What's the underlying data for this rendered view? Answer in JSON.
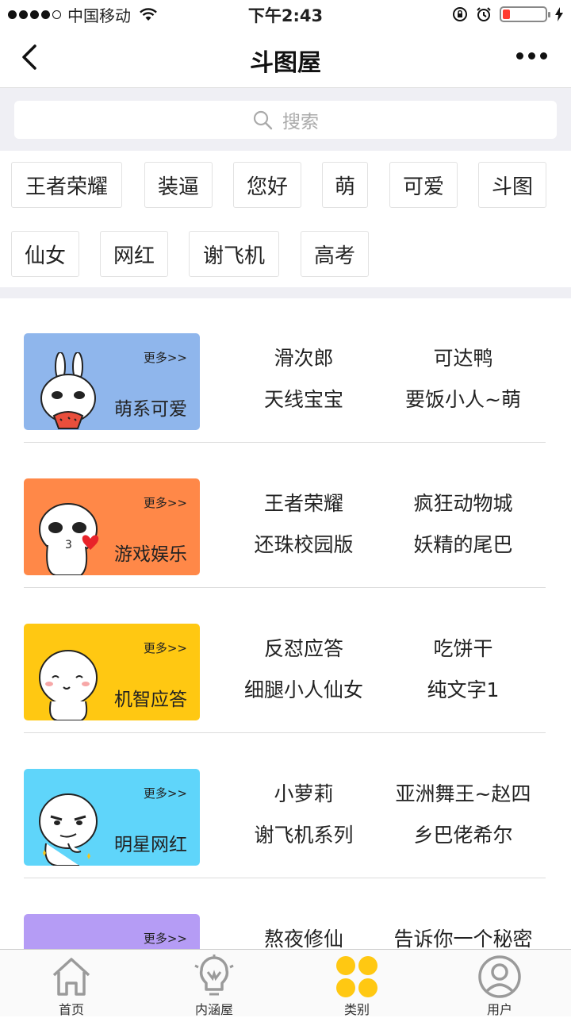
{
  "status_bar": {
    "carrier": "中国移动",
    "time": "下午2:43",
    "battery_level": 0.18
  },
  "nav": {
    "title": "斗图屋"
  },
  "search": {
    "placeholder": "搜索"
  },
  "tags": [
    "王者荣耀",
    "装逼",
    "您好",
    "萌",
    "可爱",
    "斗图",
    "仙女",
    "网红",
    "谢飞机",
    "高考"
  ],
  "categories": [
    {
      "name": "萌系可爱",
      "more": "更多>>",
      "color": "#8fb6ec",
      "links": [
        "滑次郎",
        "可达鸭",
        "天线宝宝",
        "要饭小人~萌"
      ]
    },
    {
      "name": "游戏娱乐",
      "more": "更多>>",
      "color": "#ff8848",
      "links": [
        "王者荣耀",
        "疯狂动物城",
        "还珠校园版",
        "妖精的尾巴"
      ]
    },
    {
      "name": "机智应答",
      "more": "更多>>",
      "color": "#ffc812",
      "links": [
        "反怼应答",
        "吃饼干",
        "细腿小人仙女",
        "纯文字1"
      ]
    },
    {
      "name": "明星网红",
      "more": "更多>>",
      "color": "#5fd5fa",
      "links": [
        "小萝莉",
        "亚洲舞王~赵四",
        "谢飞机系列",
        "乡巴佬希尔"
      ]
    },
    {
      "name": "",
      "more": "更多>>",
      "color": "#b59cf5",
      "links": [
        "熬夜修仙",
        "告诉你一个秘密",
        "",
        ""
      ]
    }
  ],
  "tabbar": {
    "items": [
      {
        "label": "首页",
        "icon": "home-icon"
      },
      {
        "label": "内涵屋",
        "icon": "lightbulb-icon"
      },
      {
        "label": "类别",
        "icon": "category-grid-icon"
      },
      {
        "label": "用户",
        "icon": "user-icon"
      }
    ],
    "active_index": 2,
    "active_color": "#ffc812",
    "inactive_color": "#9a9a9a"
  }
}
